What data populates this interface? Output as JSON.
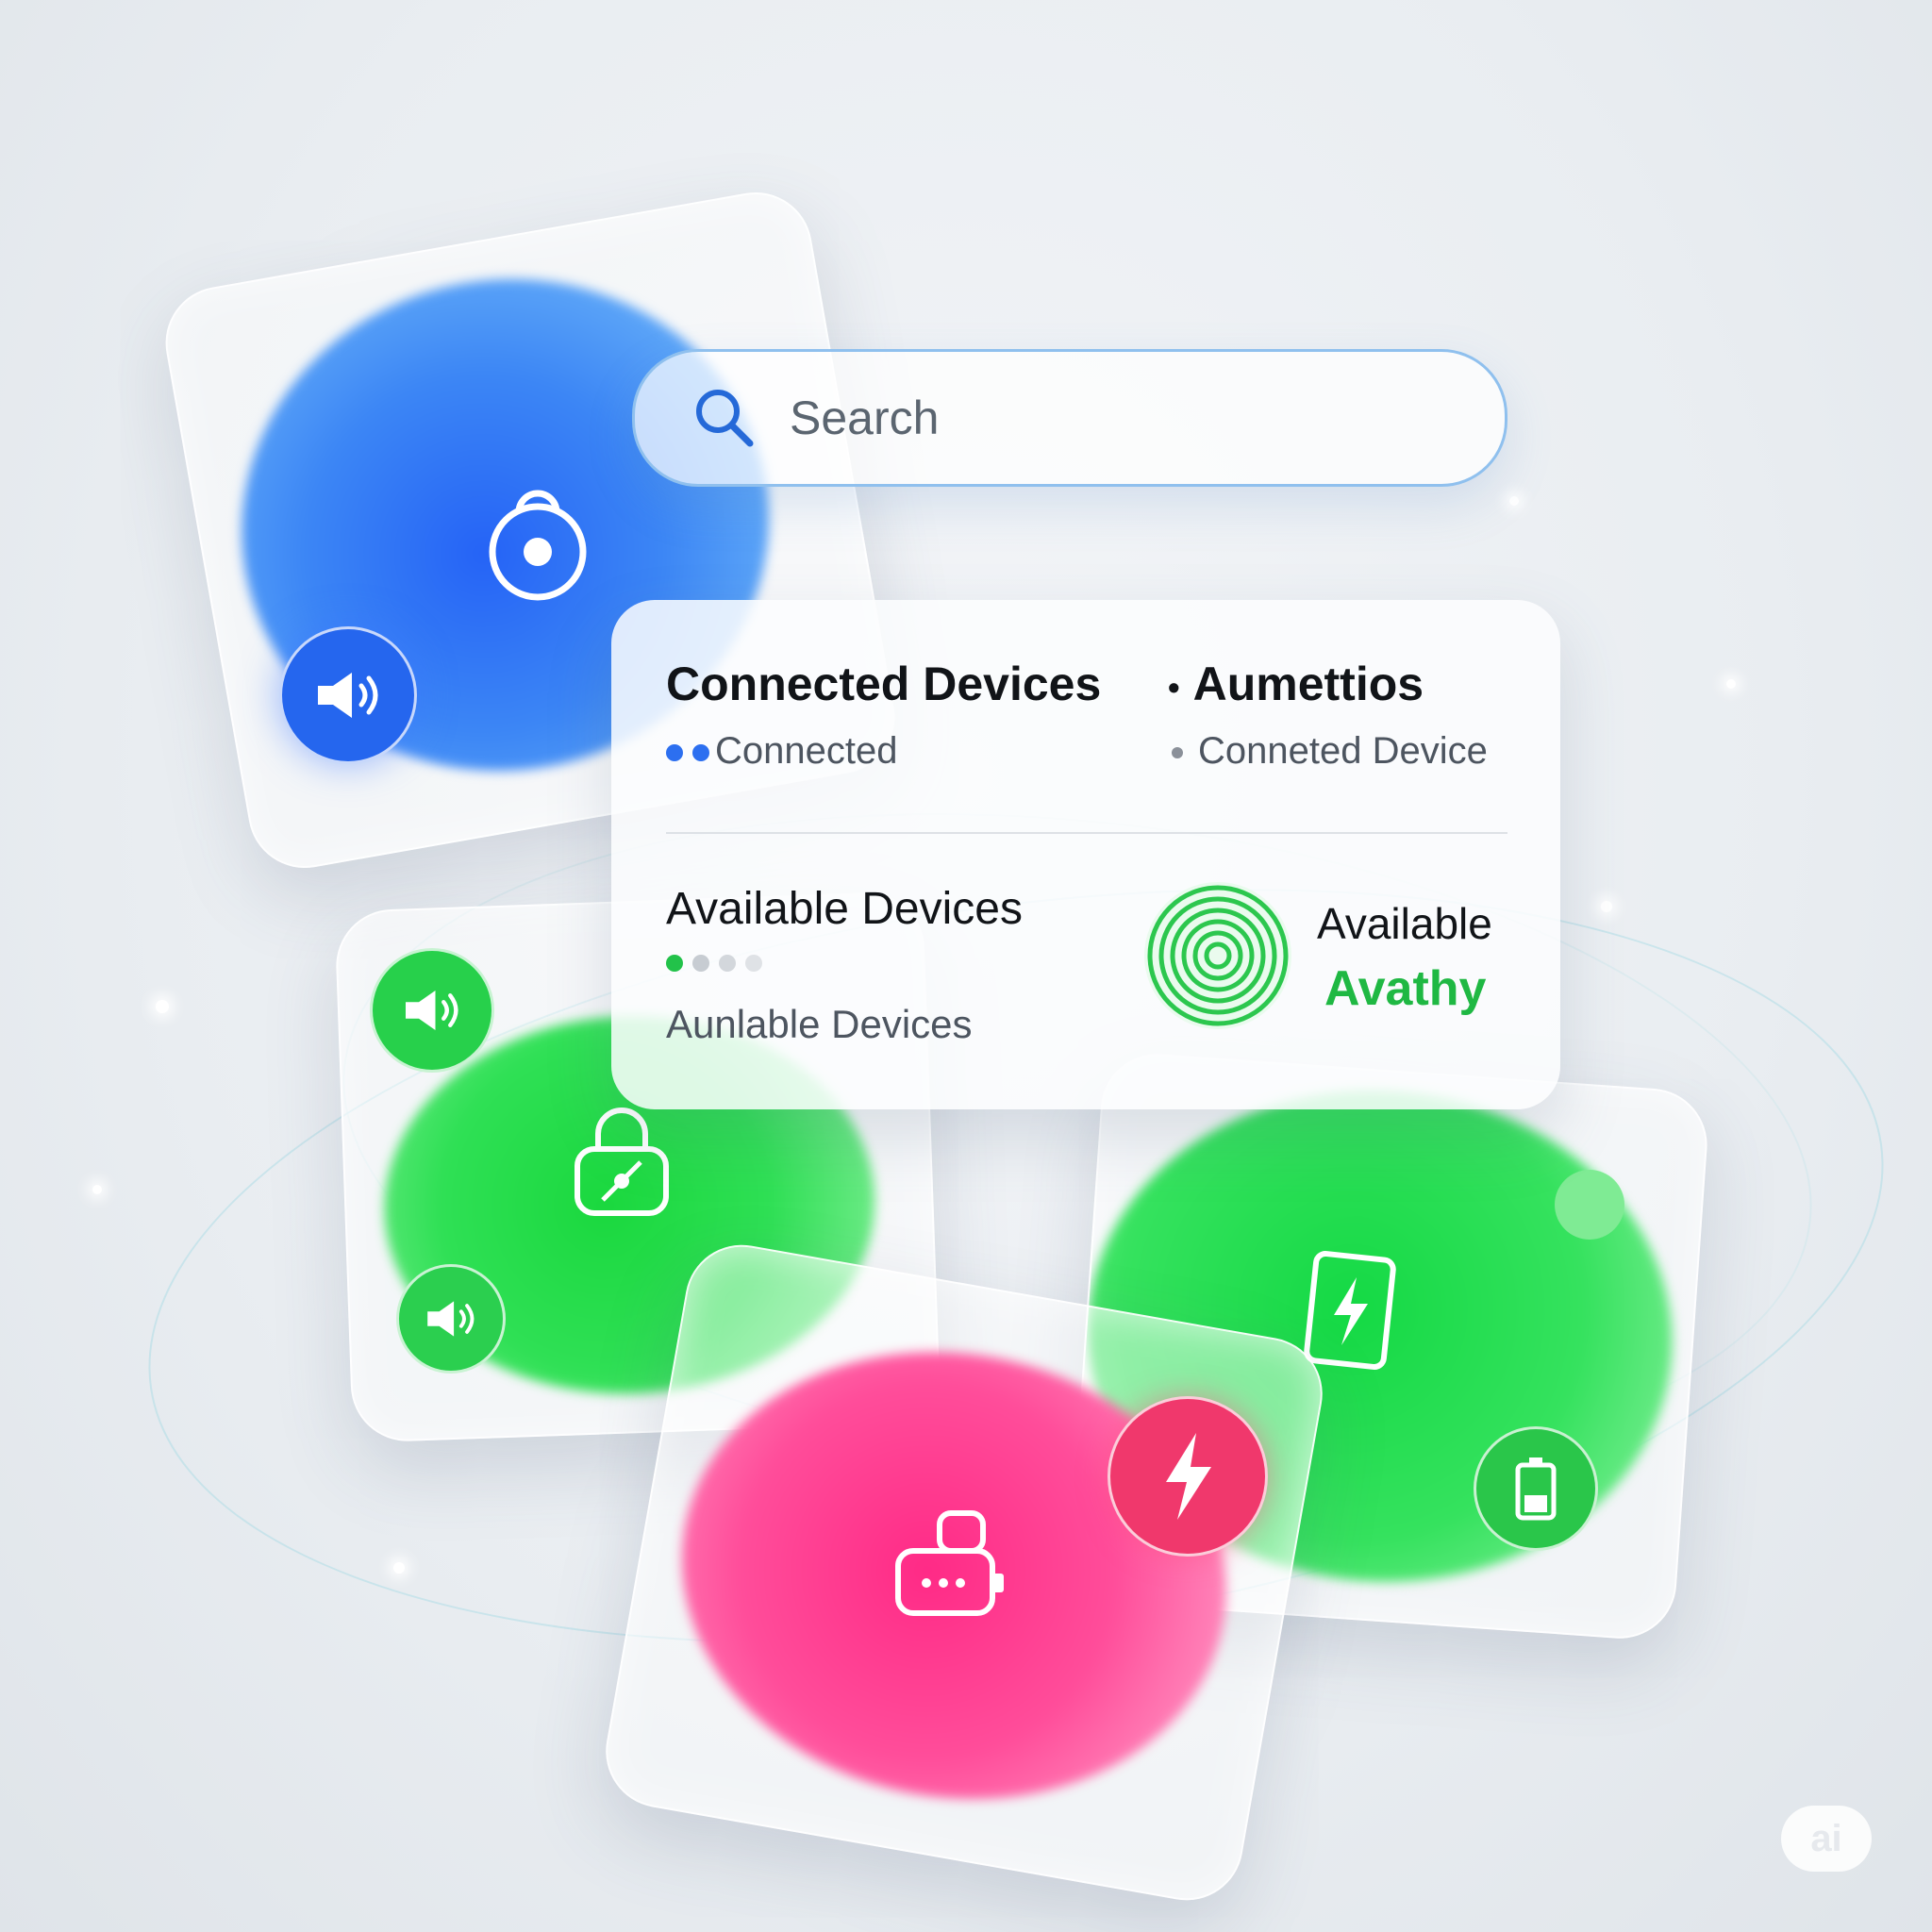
{
  "search": {
    "placeholder": "Search",
    "icon": "search-icon"
  },
  "panel": {
    "connected": {
      "title": "Connected Devices",
      "status": "Connected",
      "status_color": "#2c6ff0"
    },
    "aumettios": {
      "title": "Aumettios",
      "subtitle": "Conneted Device"
    },
    "available": {
      "title": "Available Devices",
      "subtitle": "Aunlable Devices",
      "dot_active_color": "#22c24a"
    },
    "radar": {
      "label": "Available",
      "value": "Avathy",
      "color": "#1fb843"
    }
  },
  "tiles": {
    "blue": {
      "color": "#2f6ef5",
      "icons": [
        "lock-icon",
        "speaker-icon"
      ]
    },
    "green_left": {
      "color": "#22dd44",
      "icons": [
        "speaker-icon",
        "lock-icon",
        "speaker-icon"
      ]
    },
    "green_right": {
      "color": "#1fd94a",
      "icons": [
        "battery-charging-icon",
        "battery-icon"
      ]
    },
    "pink": {
      "color": "#ff2f8a",
      "icons": [
        "lightning-icon",
        "device-icon"
      ]
    }
  },
  "badge": {
    "label": "ai"
  }
}
